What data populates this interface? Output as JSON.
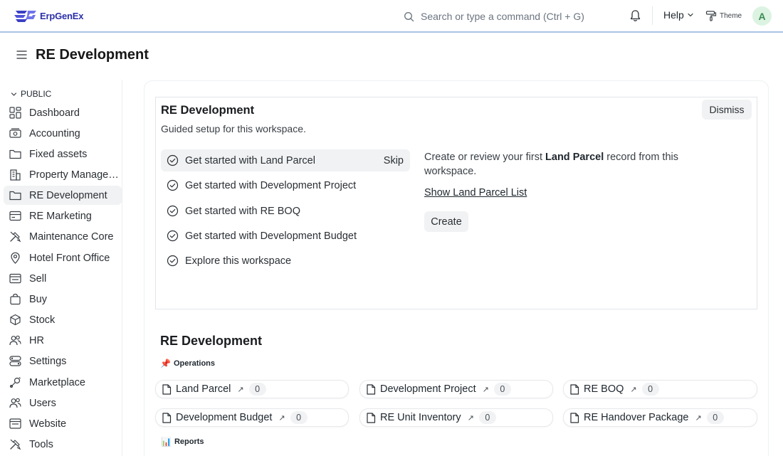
{
  "app": {
    "name": "ErpGenEx",
    "search_placeholder": "Search or type a command (Ctrl + G)",
    "help_label": "Help",
    "theme_label": "Theme",
    "avatar_initial": "A"
  },
  "page": {
    "title": "RE Development"
  },
  "sidebar": {
    "section_label": "PUBLIC",
    "items": [
      {
        "label": "Dashboard",
        "icon": "dashboard-icon"
      },
      {
        "label": "Accounting",
        "icon": "accounting-icon"
      },
      {
        "label": "Fixed assets",
        "icon": "folder-icon"
      },
      {
        "label": "Property Management",
        "icon": "building-icon"
      },
      {
        "label": "RE Development",
        "icon": "folder-icon",
        "active": true
      },
      {
        "label": "RE Marketing",
        "icon": "card-icon"
      },
      {
        "label": "Maintenance Core",
        "icon": "tools-icon"
      },
      {
        "label": "Hotel Front Office",
        "icon": "location-icon"
      },
      {
        "label": "Sell",
        "icon": "sell-icon"
      },
      {
        "label": "Buy",
        "icon": "bag-icon"
      },
      {
        "label": "Stock",
        "icon": "box-icon"
      },
      {
        "label": "HR",
        "icon": "users-icon"
      },
      {
        "label": "Settings",
        "icon": "settings-icon"
      },
      {
        "label": "Marketplace",
        "icon": "marketplace-icon"
      },
      {
        "label": "Users",
        "icon": "users-icon"
      },
      {
        "label": "Website",
        "icon": "website-icon"
      },
      {
        "label": "Tools",
        "icon": "tools-icon"
      }
    ]
  },
  "onboarding": {
    "title": "RE Development",
    "subtitle": "Guided setup for this workspace.",
    "dismiss_label": "Dismiss",
    "skip_label": "Skip",
    "steps": [
      "Get started with Land Parcel",
      "Get started with Development Project",
      "Get started with RE BOQ",
      "Get started with Development Budget",
      "Explore this workspace"
    ],
    "desc_before": "Create or review your first ",
    "desc_bold": "Land Parcel",
    "desc_after": " record from this workspace.",
    "link_label": "Show Land Parcel List",
    "create_label": "Create"
  },
  "workspace": {
    "title": "RE Development",
    "operations_label": "Operations",
    "operations_emoji": "📌",
    "reports_label": "Reports",
    "reports_emoji": "📊",
    "shortcuts": [
      {
        "label": "Land Parcel",
        "count": "0"
      },
      {
        "label": "Development Project",
        "count": "0"
      },
      {
        "label": "RE BOQ",
        "count": "0"
      },
      {
        "label": "Development Budget",
        "count": "0"
      },
      {
        "label": "RE Unit Inventory",
        "count": "0"
      },
      {
        "label": "RE Handover Package",
        "count": "0"
      }
    ]
  },
  "colors": {
    "brand": "#2b2fa8",
    "navbar_border": "#a9c3e6",
    "avatar_bg": "#dcf3e2",
    "avatar_fg": "#3e8a55"
  }
}
